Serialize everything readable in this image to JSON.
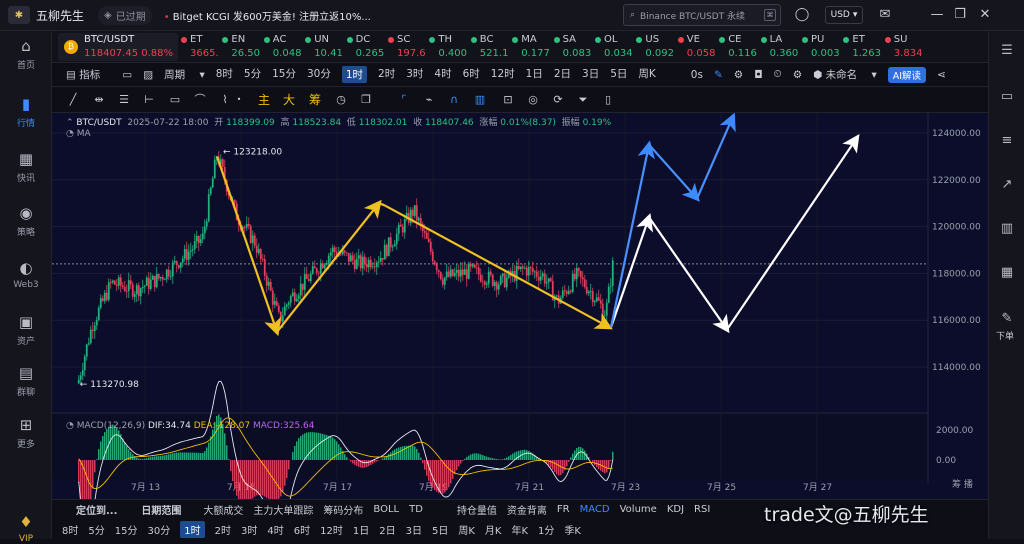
{
  "app": {
    "title": "五柳先生",
    "expired_label": "已过期",
    "promo": "Bitget KCGI 发600万美金! 注册立返10%..."
  },
  "search": {
    "placeholder": "Binance BTC/USDT 永续"
  },
  "currency": {
    "value": "USD"
  },
  "left_nav": [
    {
      "label": "首页",
      "icon": "home-icon"
    },
    {
      "label": "行情",
      "icon": "chart-bars-icon",
      "active": true
    },
    {
      "label": "快讯",
      "icon": "news-icon"
    },
    {
      "label": "策略",
      "icon": "robot-icon"
    },
    {
      "label": "Web3",
      "icon": "web3-icon"
    },
    {
      "label": "资产",
      "icon": "wallet-icon"
    },
    {
      "label": "群聊",
      "icon": "chat-icon"
    },
    {
      "label": "更多",
      "icon": "grid-icon"
    },
    {
      "label": "VIP",
      "icon": "vip-icon"
    }
  ],
  "ticker_main": {
    "symbol": "BTC/USDT",
    "price": "118407.45",
    "change": "0.88%"
  },
  "tickers": [
    {
      "sym": "ET",
      "price": "3665.",
      "color": "#f04050"
    },
    {
      "sym": "EN",
      "price": "26.50",
      "color": "#30c080"
    },
    {
      "sym": "AC",
      "price": "0.048",
      "color": "#30c080"
    },
    {
      "sym": "UN",
      "price": "10.41",
      "color": "#30c080"
    },
    {
      "sym": "DC",
      "price": "0.265",
      "color": "#30c080"
    },
    {
      "sym": "SC",
      "price": "197.6",
      "color": "#f04050"
    },
    {
      "sym": "TH",
      "price": "0.400",
      "color": "#30c080"
    },
    {
      "sym": "BC",
      "price": "521.1",
      "color": "#30c080"
    },
    {
      "sym": "MA",
      "price": "0.177",
      "color": "#30c080"
    },
    {
      "sym": "SA",
      "price": "0.083",
      "color": "#30c080"
    },
    {
      "sym": "OL",
      "price": "0.034",
      "color": "#30c080"
    },
    {
      "sym": "US",
      "price": "0.092",
      "color": "#30c080"
    },
    {
      "sym": "VE",
      "price": "0.058",
      "color": "#f04050"
    },
    {
      "sym": "CE",
      "price": "0.116",
      "color": "#30c080"
    },
    {
      "sym": "LA",
      "price": "0.360",
      "color": "#30c080"
    },
    {
      "sym": "PU",
      "price": "0.003",
      "color": "#30c080"
    },
    {
      "sym": "ET",
      "price": "1.263",
      "color": "#30c080"
    },
    {
      "sym": "SU",
      "price": "3.834",
      "color": "#f04050"
    }
  ],
  "toolbar1": {
    "indicator": "指标",
    "period": "周期",
    "intervals": [
      "8时",
      "5分",
      "15分",
      "30分",
      "1时",
      "2时",
      "3时",
      "4时",
      "6时",
      "12时",
      "1日",
      "2日",
      "3日",
      "5日",
      "周K"
    ],
    "selected": "1时",
    "countdown": "0s",
    "layout_name": "未命名",
    "ai_label": "AI解读"
  },
  "toolbar2": {
    "labels": [
      "主",
      "大",
      "筹"
    ]
  },
  "info": {
    "symbol": "BTC/USDT",
    "date": "2025-07-22 18:00",
    "open_label": "开",
    "open": "118399.09",
    "high_label": "高",
    "high": "118523.84",
    "low_label": "低",
    "low": "118302.01",
    "close_label": "收",
    "close": "118407.46",
    "chg_label": "涨幅",
    "chg": "0.01%(8.37)",
    "amp_label": "振幅",
    "amp": "0.19%",
    "ma_label": "MA"
  },
  "macd": {
    "label": "MACD(12,26,9)",
    "dif": "DIF:34.74",
    "dea": "DEA:-128.07",
    "macd": "MACD:325.64"
  },
  "chart_data": {
    "type": "candlestick",
    "ylim": [
      112500,
      125000
    ],
    "yticks": [
      "124000.00",
      "122000.00",
      "120000.00",
      "118000.00",
      "116000.00",
      "114000.00"
    ],
    "ytick_values": [
      124000,
      122000,
      120000,
      118000,
      116000,
      114000
    ],
    "xticks": [
      "7月 13",
      "7月 15",
      "7月 17",
      "7月 19",
      "7月 21",
      "7月 23",
      "7月 25",
      "7月 27"
    ],
    "high_marker": "123218.00",
    "low_marker": "113270.98",
    "current_price": 118407,
    "macd_yticks": [
      "2000.00",
      "0.00"
    ],
    "macd_ylim": [
      -1200,
      2500
    ],
    "yellow_path": [
      [
        "7月14 12时",
        123000
      ],
      [
        "7月15 18时",
        115500
      ],
      [
        "7月17 21时",
        121000
      ],
      [
        "7月18 00时",
        120900
      ],
      [
        "7月22 16时",
        115700
      ]
    ],
    "blue_path": [
      [
        "7月22 17时",
        115700
      ],
      [
        "7月23 12时",
        123500
      ],
      [
        "7月24 12时",
        121200
      ],
      [
        "7月25 06时",
        124700
      ]
    ],
    "white_path": [
      [
        "7月22 17时",
        115700
      ],
      [
        "7月23 12时",
        120400
      ],
      [
        "7月25 03时",
        115600
      ],
      [
        "7月27 20时",
        123800
      ]
    ]
  },
  "bottom": {
    "left_items": [
      "定位到...",
      "日期范围",
      "大额成交",
      "主力大单跟踪",
      "筹码分布",
      "BOLL",
      "TD"
    ],
    "right_items": [
      "持仓量值",
      "资金背离",
      "FR",
      "MACD",
      "Volume",
      "KDJ",
      "RSI"
    ],
    "right_axis_label": "筹 播"
  },
  "timebar": {
    "items": [
      "8时",
      "5分",
      "15分",
      "30分",
      "1时",
      "2时",
      "3时",
      "4时",
      "6时",
      "12时",
      "1日",
      "2日",
      "3日",
      "5日",
      "周K",
      "月K",
      "年K",
      "1分",
      "季K"
    ],
    "selected": "1时"
  },
  "watermark": "trade文@五柳先生",
  "right_nav_label": "下单"
}
